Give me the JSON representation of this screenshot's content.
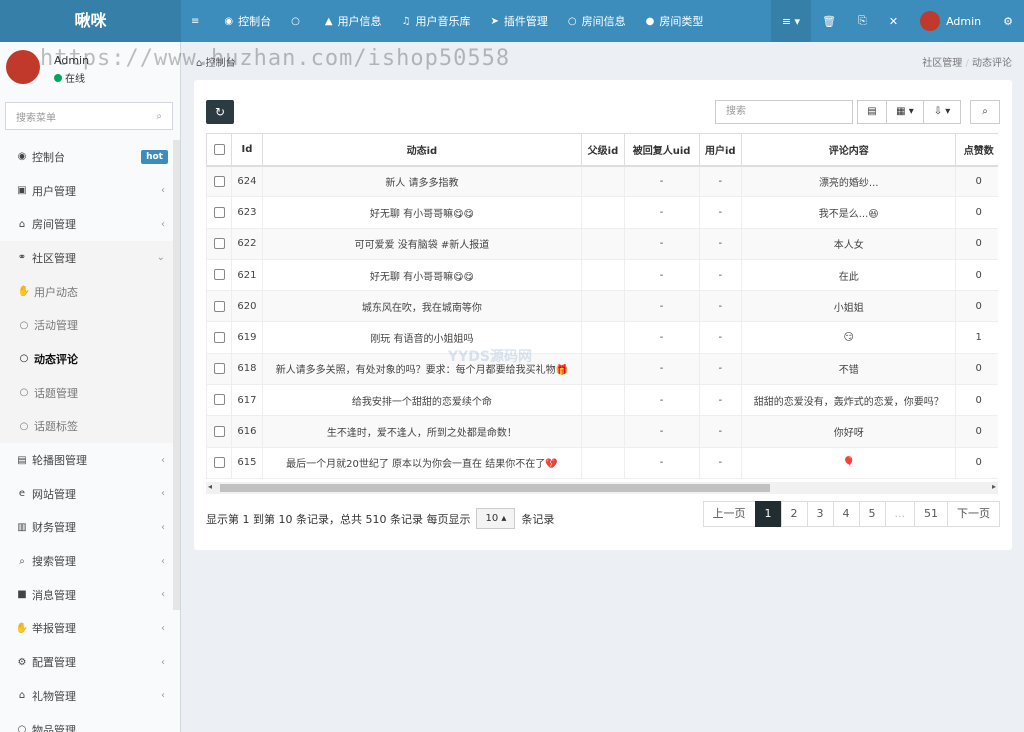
{
  "app_title": "啾咪",
  "topnav": [
    {
      "icon": "≡",
      "label": ""
    },
    {
      "icon": "◉",
      "label": "控制台"
    },
    {
      "icon": "○",
      "label": ""
    },
    {
      "icon": "▲",
      "label": "用户信息"
    },
    {
      "icon": "♫",
      "label": "用户音乐库"
    },
    {
      "icon": "➤",
      "label": "插件管理"
    },
    {
      "icon": "○",
      "label": "房间信息"
    },
    {
      "icon": "●",
      "label": "房间类型"
    }
  ],
  "rightnav": {
    "menu": "≡ ▾",
    "trash": "🗑",
    "copy": "⎘",
    "fullscreen": "✕",
    "username": "Admin",
    "settings": "⚙"
  },
  "user": {
    "name": "Admin",
    "status": "在线"
  },
  "sidebar_search": "搜索菜单",
  "menu": [
    {
      "icon": "◉",
      "label": "控制台",
      "badge": "hot"
    },
    {
      "icon": "▣",
      "label": "用户管理",
      "arrow": "‹"
    },
    {
      "icon": "⌂",
      "label": "房间管理",
      "arrow": "‹"
    },
    {
      "icon": "⚭",
      "label": "社区管理",
      "arrow": "⌄"
    }
  ],
  "submenu": [
    {
      "icon": "✋",
      "label": "用户动态"
    },
    {
      "icon": "○",
      "label": "活动管理"
    },
    {
      "icon": "○",
      "label": "动态评论"
    },
    {
      "icon": "○",
      "label": "话题管理"
    },
    {
      "icon": "○",
      "label": "话题标签"
    }
  ],
  "menu2": [
    {
      "icon": "▤",
      "label": "轮播图管理",
      "arrow": "‹"
    },
    {
      "icon": "e",
      "label": "网站管理",
      "arrow": "‹"
    },
    {
      "icon": "▥",
      "label": "财务管理",
      "arrow": "‹"
    },
    {
      "icon": "⌕",
      "label": "搜索管理",
      "arrow": "‹"
    },
    {
      "icon": "■",
      "label": "消息管理",
      "arrow": "‹"
    },
    {
      "icon": "✋",
      "label": "举报管理",
      "arrow": "‹"
    },
    {
      "icon": "⚙",
      "label": "配置管理",
      "arrow": "‹"
    },
    {
      "icon": "⌂",
      "label": "礼物管理",
      "arrow": "‹"
    },
    {
      "icon": "○",
      "label": "物品管理",
      "arrow": ""
    }
  ],
  "breadcrumb": {
    "home": "控制台",
    "parent": "社区管理",
    "sep": "/",
    "current": "动态评论"
  },
  "toolbar": {
    "search_placeholder": "搜索",
    "refresh": "↻",
    "toggle": "▤",
    "columns": "▦ ▾",
    "export": "⇩ ▾",
    "search_btn": "⌕"
  },
  "columns": [
    "Id",
    "动态id",
    "父级id",
    "被回复人uid",
    "用户id",
    "评论内容",
    "点赞数"
  ],
  "rows": [
    {
      "id": "624",
      "moment": "新人 请多多指教",
      "parent": "",
      "reply": "-",
      "uid": "-",
      "content": "漂亮的婚纱...",
      "likes": "0"
    },
    {
      "id": "623",
      "moment": "好无聊 有小哥哥嘛😋😋",
      "parent": "",
      "reply": "-",
      "uid": "-",
      "content": "我不是么...😆",
      "likes": "0"
    },
    {
      "id": "622",
      "moment": "可可爱爱 没有脑袋 #新人报道",
      "parent": "",
      "reply": "-",
      "uid": "-",
      "content": "本人女",
      "likes": "0"
    },
    {
      "id": "621",
      "moment": "好无聊 有小哥哥嘛😋😋",
      "parent": "",
      "reply": "-",
      "uid": "-",
      "content": "在此",
      "likes": "0"
    },
    {
      "id": "620",
      "moment": "城东风在吹，我在城南等你",
      "parent": "",
      "reply": "-",
      "uid": "-",
      "content": "小姐姐",
      "likes": "0"
    },
    {
      "id": "619",
      "moment": "刚玩 有语音的小姐姐吗",
      "parent": "",
      "reply": "-",
      "uid": "-",
      "content": "😏",
      "likes": "1"
    },
    {
      "id": "618",
      "moment": "新人请多多关照，有处对象的吗？要求：每个月都要给我买礼物🎁",
      "parent": "",
      "reply": "-",
      "uid": "-",
      "content": "不错",
      "likes": "0"
    },
    {
      "id": "617",
      "moment": "给我安排一个甜甜的恋爱续个命",
      "parent": "",
      "reply": "-",
      "uid": "-",
      "content": "甜甜的恋爱没有，轰炸式的恋爱，你要吗？",
      "likes": "0"
    },
    {
      "id": "616",
      "moment": "生不逢时，爱不逢人，所到之处都是命数！",
      "parent": "",
      "reply": "-",
      "uid": "-",
      "content": "你好呀",
      "likes": "0"
    },
    {
      "id": "615",
      "moment": "最后一个月就20世纪了 原本以为你会一直在 结果你不在了💔",
      "parent": "",
      "reply": "-",
      "uid": "-",
      "content": "🎈",
      "likes": "0"
    }
  ],
  "pagination": {
    "info_pre": "显示第 1 到第 10 条记录，总共 510 条记录 每页显示",
    "page_size": "10 ▴",
    "info_post": "条记录",
    "prev": "上一页",
    "next": "下一页",
    "pages": [
      "1",
      "2",
      "3",
      "4",
      "5",
      "...",
      "51"
    ]
  },
  "watermark": "https://www.huzhan.com/ishop50558",
  "watermark2": "YYDS源码网"
}
